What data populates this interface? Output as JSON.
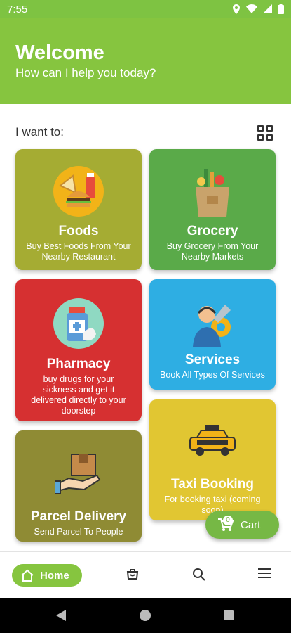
{
  "status_bar": {
    "time": "7:55"
  },
  "header": {
    "title": "Welcome",
    "subtitle": "How can I help you today?"
  },
  "section": {
    "label": "I want to:"
  },
  "cards": [
    {
      "title": "Foods",
      "description": "Buy Best Foods From Your Nearby Restaurant",
      "color": "#a5ac33"
    },
    {
      "title": "Grocery",
      "description": "Buy Grocery From Your Nearby Markets",
      "color": "#5aaa49"
    },
    {
      "title": "Pharmacy",
      "description": "buy drugs for your sickness and get it delivered directly to your doorstep",
      "color": "#d63031"
    },
    {
      "title": "Services",
      "description": "Book All Types Of Services",
      "color": "#2eaee3"
    },
    {
      "title": "Parcel Delivery",
      "description": "Send Parcel To People",
      "color": "#8f8b34"
    },
    {
      "title": "Taxi Booking",
      "description": "For booking taxi (coming soon)",
      "color": "#e1c632"
    }
  ],
  "cart": {
    "label": "Cart",
    "count": "0"
  },
  "bottom_nav": {
    "home_label": "Home"
  },
  "colors": {
    "accent": "#86c53f",
    "cart": "#76b845"
  }
}
